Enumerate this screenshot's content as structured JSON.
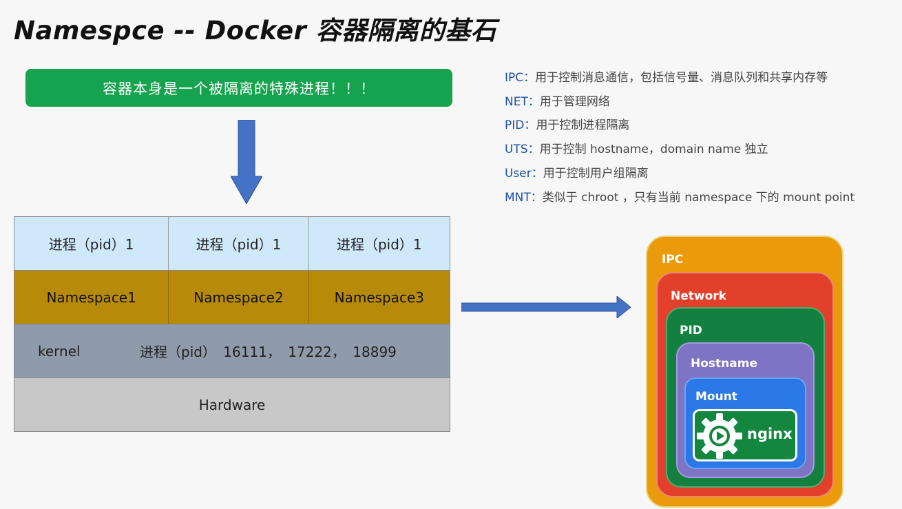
{
  "title": "Namespce -- Docker 容器隔离的基石",
  "banner": "容器本身是一个被隔离的特殊进程！！！",
  "stack": {
    "process_row": [
      "进程（pid）1",
      "进程（pid）1",
      "进程（pid）1"
    ],
    "namespace_row": [
      "Namespace1",
      "Namespace2",
      "Namespace3"
    ],
    "kernel_label": "kernel",
    "kernel_pids": "进程（pid） 16111， 17222， 18899",
    "hardware": "Hardware"
  },
  "legend": [
    {
      "key": "IPC：",
      "desc": "用于控制消息通信，包括信号量、消息队列和共享内存等"
    },
    {
      "key": "NET：",
      "desc": "用于管理网络"
    },
    {
      "key": "PID：",
      "desc": "用于控制进程隔离"
    },
    {
      "key": "UTS：",
      "desc": "用于控制 hostname，domain name 独立"
    },
    {
      "key": "User：",
      "desc": "用于控制用户组隔离"
    },
    {
      "key": "MNT：",
      "desc": "类似于 chroot ，只有当前 namespace 下的 mount point"
    }
  ],
  "nesting": {
    "ipc": "IPC",
    "network": "Network",
    "pid": "PID",
    "hostname": "Hostname",
    "mount": "Mount",
    "app": "nginx"
  },
  "colors": {
    "banner": "#16a34f",
    "process_row": "#cfe8fa",
    "namespace_row": "#b88a0a",
    "kernel_row": "#8f9aab",
    "hardware_row": "#c8c8c8",
    "arrow": "#4472c4",
    "ipc": "#eb9a0b",
    "network": "#e2402a",
    "pid": "#13803f",
    "hostname": "#7f73c3",
    "mount": "#2b78e8"
  }
}
